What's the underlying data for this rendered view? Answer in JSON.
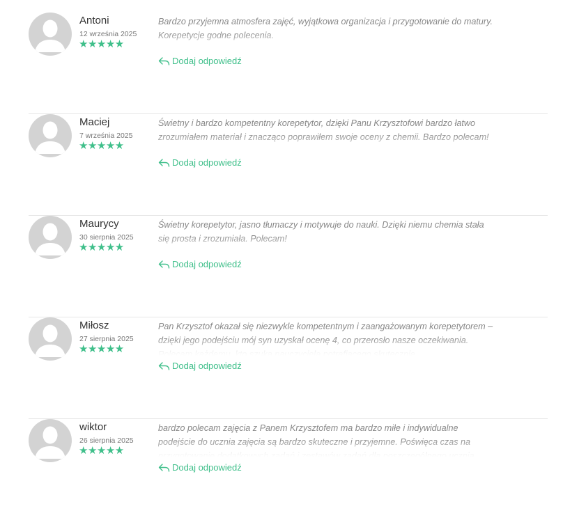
{
  "reviews": [
    {
      "author": "Antoni",
      "date": "12 września 2025",
      "stars": "★★★★★",
      "rating": 5,
      "text": "Bardzo przyjemna atmosfera zajęć, wyjątkowa organizacja i przygotowanie do matury. Korepetycje godne polecenia."
    },
    {
      "author": "Maciej",
      "date": "7 września 2025",
      "stars": "★★★★★",
      "rating": 5,
      "text": "Świetny i bardzo kompetentny korepetytor, dzięki Panu Krzysztofowi bardzo łatwo zrozumiałem materiał i znacząco poprawiłem swoje oceny z chemii. Bardzo polecam!"
    },
    {
      "author": "Maurycy",
      "date": "30 sierpnia 2025",
      "stars": "★★★★★",
      "rating": 5,
      "text": "Świetny korepetytor, jasno tłumaczy i motywuje do nauki. Dzięki niemu chemia stała się prosta i zrozumiała. Polecam!"
    },
    {
      "author": "Miłosz",
      "date": "27 sierpnia 2025",
      "stars": "★★★★★",
      "rating": 5,
      "text": "Pan Krzysztof okazał się niezwykle kompetentnym i zaangażowanym korepetytorem – dzięki jego podejściu mój syn uzyskał ocenę 4, co przerosło nasze oczekiwania. Polecam każdemu, kto szuka nauczyciela potrafiącego skutecznie"
    },
    {
      "author": "wiktor",
      "date": "26 sierpnia 2025",
      "stars": "★★★★★",
      "rating": 5,
      "text": "bardzo polecam zajęcia z Panem Krzysztofem ma bardzo miłe i indywidualne podejście do ucznia zajęcia są bardzo skuteczne i przyjemne. Poświęca czas na przygotowanie dodatkowych zadań i zestawów zadań dla poszczególnego ucznia"
    }
  ],
  "reply_label": "Dodaj odpowiedź",
  "colors": {
    "accent": "#3fbf8a",
    "avatar_bg": "#d3d3d3",
    "divider": "#e6e6e6",
    "text_muted": "#888888"
  },
  "icons": {
    "avatar": "user-silhouette-icon",
    "reply": "reply-arrow-icon",
    "star": "star-icon"
  }
}
